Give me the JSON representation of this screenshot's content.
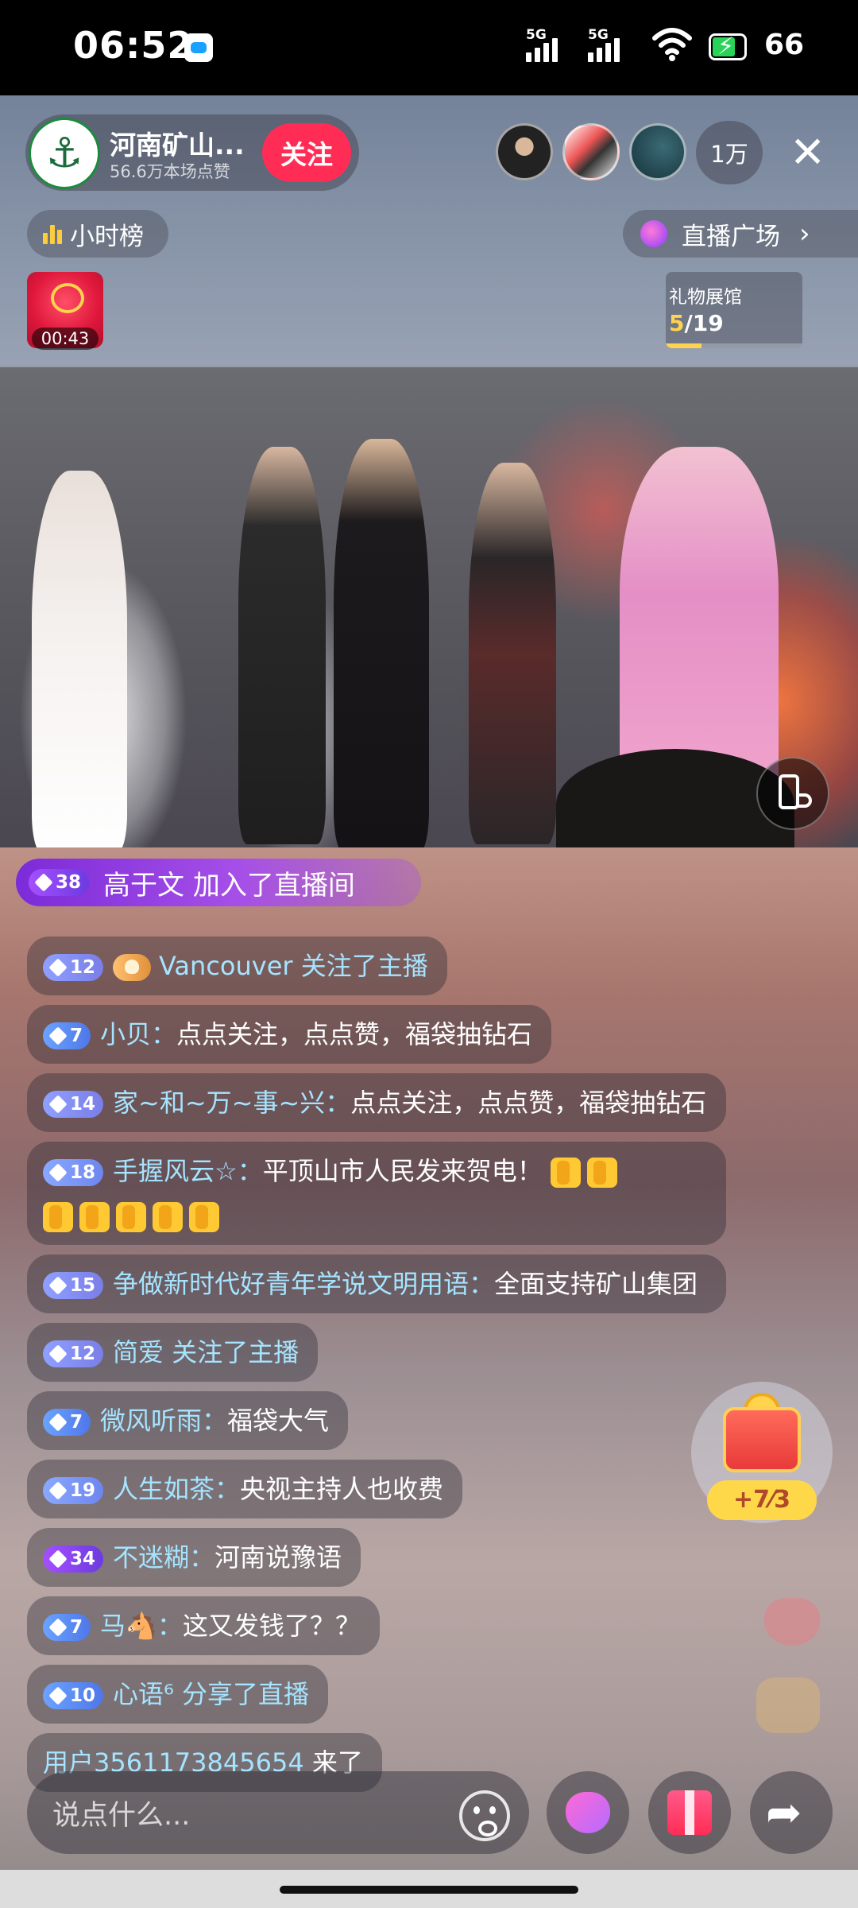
{
  "status_bar": {
    "time": "06:52",
    "sim1": "5G",
    "sim2": "5G",
    "battery": "66"
  },
  "host": {
    "name": "河南矿山...",
    "likes": "56.6万本场点赞",
    "follow_label": "关注"
  },
  "viewers": {
    "count": "1万"
  },
  "top_bar": {
    "hour_rank_label": "小时榜",
    "plaza_label": "直播广场",
    "plaza_chevron": "›"
  },
  "fukubag": {
    "timer": "00:43"
  },
  "gift_hall": {
    "title": "礼物展馆",
    "progress_current": "5",
    "progress_total": "/19",
    "progress_fraction": 0.26
  },
  "join_banner": {
    "level": "38",
    "text": "高于文 加入了直播间"
  },
  "chat": [
    {
      "level": "12",
      "fan_badge": true,
      "user": "Vancouver",
      "text": " 关注了主播"
    },
    {
      "level": "7",
      "user": "小贝：",
      "text": "点点关注，点点赞，福袋抽钻石"
    },
    {
      "level": "14",
      "user": "家~和~万~事~兴：",
      "text": "点点关注，点点赞，福袋抽钻石"
    },
    {
      "level": "18",
      "user": "手握风云☆：",
      "text": "平顶山市人民发来贺电！"
    },
    {
      "level": "15",
      "user": "争做新时代好青年学说文明用语：",
      "text": "全面支持矿山集团"
    },
    {
      "level": "12",
      "user": "简爱",
      "text": " 关注了主播"
    },
    {
      "level": "7",
      "user": "微风听雨：",
      "text": "福袋大气"
    },
    {
      "level": "19",
      "user": "人生如茶：",
      "text": "央视主持人也收费"
    },
    {
      "level": "34",
      "user": "不迷糊：",
      "text": "河南说豫语"
    },
    {
      "level": "7",
      "user": "马🐴：",
      "text": "这又发钱了？？"
    },
    {
      "level": "10",
      "user": "心语⁶",
      "text": " 分享了直播"
    },
    {
      "user": "用户3561173845654",
      "text": " 来了"
    }
  ],
  "treasure": {
    "label": "+7⁄3"
  },
  "input": {
    "placeholder": "说点什么..."
  },
  "colors": {
    "follow": "#ff2d55",
    "join_banner": "#7b2bd8",
    "username": "#a5e4ff"
  }
}
